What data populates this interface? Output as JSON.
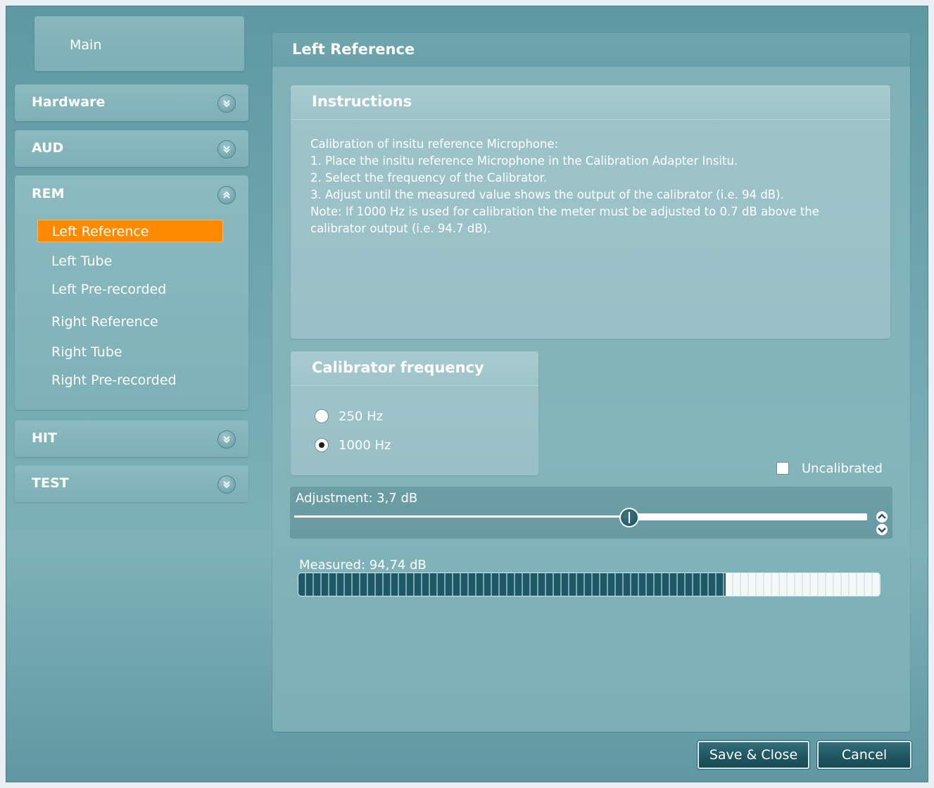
{
  "sidebar": {
    "main_label": "Main",
    "sections": [
      {
        "label": "Hardware",
        "expanded": false
      },
      {
        "label": "AUD",
        "expanded": false
      },
      {
        "label": "REM",
        "expanded": true
      },
      {
        "label": "HIT",
        "expanded": false
      },
      {
        "label": "TEST",
        "expanded": false
      }
    ],
    "rem_items": [
      {
        "label": "Left Reference",
        "active": true
      },
      {
        "label": "Left Tube",
        "active": false
      },
      {
        "label": "Left Pre-recorded",
        "active": false
      },
      {
        "label": "Right Reference",
        "active": false
      },
      {
        "label": "Right Tube",
        "active": false
      },
      {
        "label": "Right Pre-recorded",
        "active": false
      }
    ]
  },
  "main": {
    "title": "Left Reference",
    "instructions": {
      "title": "Instructions",
      "lines": [
        "Calibration of insitu reference Microphone:",
        "1. Place the insitu reference Microphone in the Calibration Adapter Insitu.",
        "2. Select the frequency of the Calibrator.",
        "3. Adjust until the measured value shows the output of the calibrator (i.e. 94 dB).",
        "Note: If 1000 Hz is used for calibration the meter must be adjusted to 0.7 dB above the",
        "calibrator output (i.e. 94.7 dB)."
      ]
    },
    "calibrator": {
      "title": "Calibrator frequency",
      "options": [
        {
          "label": "250 Hz",
          "checked": false
        },
        {
          "label": "1000 Hz",
          "checked": true
        }
      ]
    },
    "uncalibrated": {
      "label": "Uncalibrated",
      "checked": false
    },
    "adjustment": {
      "label": "Adjustment: 3,7 dB",
      "slider_fraction": 0.585
    },
    "measured": {
      "label": "Measured: 94,74 dB",
      "level_fraction": 0.735
    }
  },
  "buttons": {
    "save_close": "Save & Close",
    "cancel": "Cancel"
  },
  "colors": {
    "accent_orange": "#ff8a00",
    "panel_teal": "#7fb2b8",
    "button_dark": "#1f5662",
    "meter_fill": "#1d5866"
  }
}
